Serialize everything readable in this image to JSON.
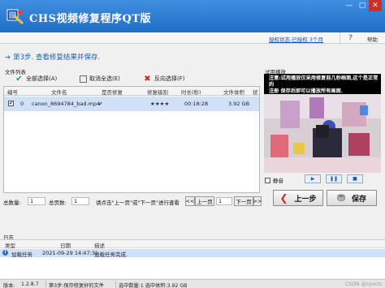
{
  "window": {
    "title": "CHS视频修复程序QT版",
    "controls": [
      "minimize",
      "maximize",
      "close"
    ]
  },
  "infobar": {
    "registration": "授权状态:已授权 3个月",
    "help_label": "帮助"
  },
  "step": {
    "title": "第3步. 查看修复结果并保存."
  },
  "file_list": {
    "label": "文件列表",
    "toolbar": {
      "select_all": "全部选择(A)",
      "deselect_all": "取消全选(E)",
      "invert_select": "反向选择(F)"
    },
    "columns": [
      "编号",
      "文件名",
      "是否修复",
      "修复级别",
      "时长(秒)",
      "文件体积",
      "状"
    ],
    "rows": [
      {
        "checked": true,
        "index": "0",
        "filename": "canon_8694784_bad.mp4",
        "repaired": "✔",
        "level": "★★★★",
        "duration": "00:18:28",
        "size": "3.92 GB"
      }
    ]
  },
  "preview": {
    "label": "试用播放",
    "subtitle_line1": "注意:试用播放仅采用修复前几秒画面,这个是正常的",
    "subtitle_line2": "注册 保存后即可以播放所有画面."
  },
  "player": {
    "mute_label": "静音",
    "buttons": [
      "play",
      "pause",
      "stop"
    ]
  },
  "actions": {
    "prev_label": "上一步",
    "save_label": "保存"
  },
  "pager": {
    "total_label": "总数量:",
    "total_value": "1",
    "pages_label": "总页数:",
    "pages_value": "1",
    "hint": "请点击\"上一页\"或\"下一页\"进行查看",
    "prev_btn": "<<",
    "prev_page": "上一页",
    "page_value": "1",
    "next_page": "下一页",
    "next_btn": ">>"
  },
  "log": {
    "label": "日志",
    "columns": [
      "类型",
      "日期",
      "描述"
    ],
    "rows": [
      {
        "type": "加载任务",
        "date": "2021-09-29 14:47:31",
        "desc": "加载任务完成."
      }
    ]
  },
  "status": {
    "version_label": "版本:",
    "version": "1.2.8.7",
    "step": "第3步:保存修复好的文件",
    "selection": "选中数量:1 选中体积:3.92 GB",
    "selection_size": "选中容量:3.92 GB",
    "watermark": "CSDN @cpxcls"
  },
  "colors": {
    "titlebar": "#2a7bd6",
    "accent": "#1f5fa8",
    "selection": "#cfe0f8"
  }
}
